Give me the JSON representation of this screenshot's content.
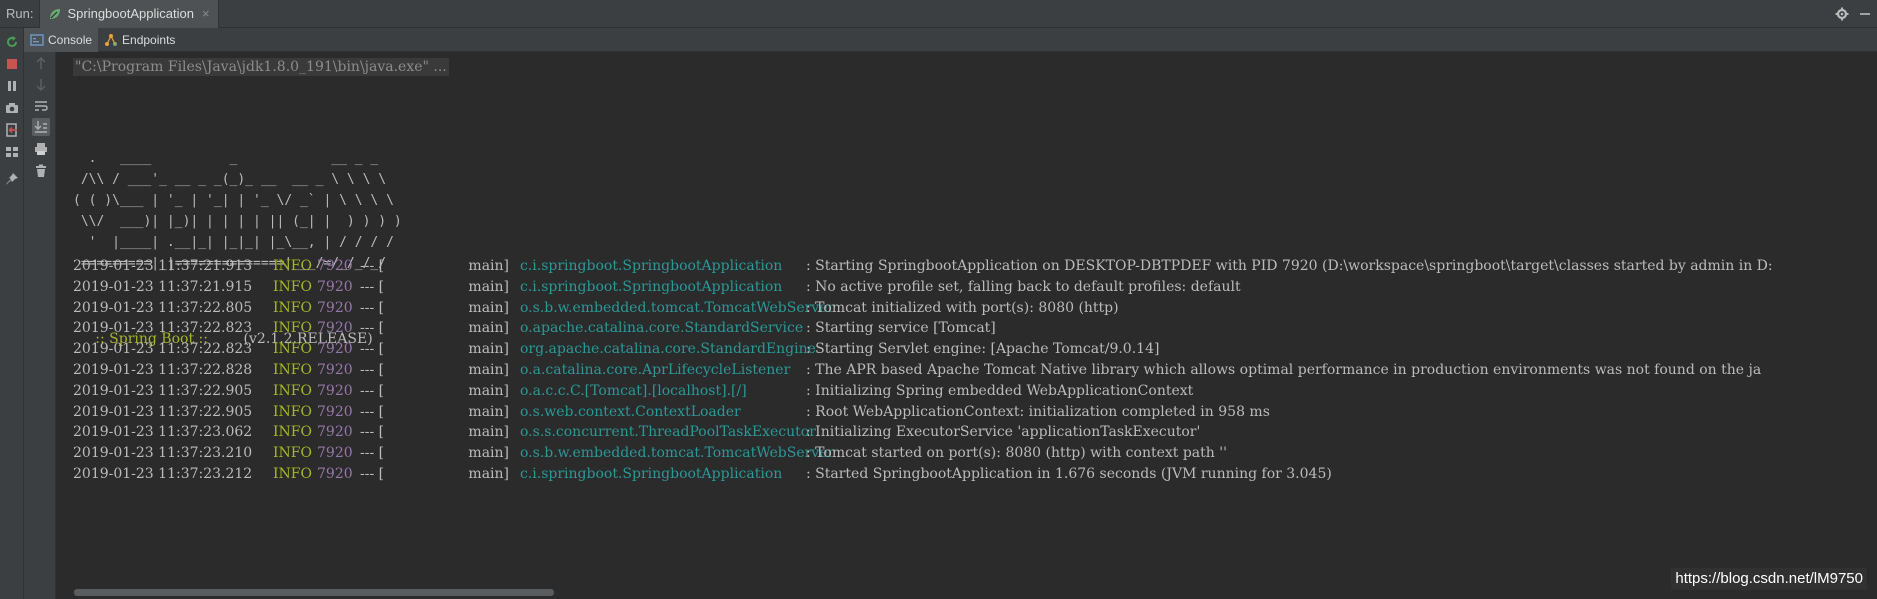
{
  "run_bar": {
    "label": "Run:",
    "tab_title": "SpringbootApplication",
    "tab_close": "×"
  },
  "sub_tabs": [
    {
      "label": "Console"
    },
    {
      "label": "Endpoints"
    }
  ],
  "console": {
    "command": "\"C:\\Program Files\\Java\\jdk1.8.0_191\\bin\\java.exe\" ...",
    "banner": "  .   ____          _            __ _ _\n /\\\\ / ___'_ __ _ _(_)_ __  __ _ \\ \\ \\ \\\n( ( )\\___ | '_ | '_| | '_ \\/ _` | \\ \\ \\ \\\n \\\\/  ___)| |_)| | | | | || (_| |  ) ) ) )\n  '  |____| .__|_| |_|_| |_\\__, | / / / /\n =========|_|==============|___/=/_/_/_/",
    "spring_name": " :: Spring Boot :: ",
    "spring_version": "       (v2.1.2.RELEASE)",
    "log_lines": [
      {
        "ts": "2019-01-23 11:37:21.913",
        "level": "INFO",
        "pid": "7920",
        "sep": "--- [",
        "thread": "main]",
        "logger": "c.i.springboot.SpringbootApplication",
        "msg": ": Starting SpringbootApplication on DESKTOP-DBTPDEF with PID 7920 (D:\\workspace\\springboot\\target\\classes started by admin in D:"
      },
      {
        "ts": "2019-01-23 11:37:21.915",
        "level": "INFO",
        "pid": "7920",
        "sep": "--- [",
        "thread": "main]",
        "logger": "c.i.springboot.SpringbootApplication",
        "msg": ": No active profile set, falling back to default profiles: default"
      },
      {
        "ts": "2019-01-23 11:37:22.805",
        "level": "INFO",
        "pid": "7920",
        "sep": "--- [",
        "thread": "main]",
        "logger": "o.s.b.w.embedded.tomcat.TomcatWebServer",
        "msg": ": Tomcat initialized with port(s): 8080 (http)"
      },
      {
        "ts": "2019-01-23 11:37:22.823",
        "level": "INFO",
        "pid": "7920",
        "sep": "--- [",
        "thread": "main]",
        "logger": "o.apache.catalina.core.StandardService",
        "msg": ": Starting service [Tomcat]"
      },
      {
        "ts": "2019-01-23 11:37:22.823",
        "level": "INFO",
        "pid": "7920",
        "sep": "--- [",
        "thread": "main]",
        "logger": "org.apache.catalina.core.StandardEngine",
        "msg": ": Starting Servlet engine: [Apache Tomcat/9.0.14]"
      },
      {
        "ts": "2019-01-23 11:37:22.828",
        "level": "INFO",
        "pid": "7920",
        "sep": "--- [",
        "thread": "main]",
        "logger": "o.a.catalina.core.AprLifecycleListener",
        "msg": ": The APR based Apache Tomcat Native library which allows optimal performance in production environments was not found on the ja"
      },
      {
        "ts": "2019-01-23 11:37:22.905",
        "level": "INFO",
        "pid": "7920",
        "sep": "--- [",
        "thread": "main]",
        "logger": "o.a.c.c.C.[Tomcat].[localhost].[/]",
        "msg": ": Initializing Spring embedded WebApplicationContext"
      },
      {
        "ts": "2019-01-23 11:37:22.905",
        "level": "INFO",
        "pid": "7920",
        "sep": "--- [",
        "thread": "main]",
        "logger": "o.s.web.context.ContextLoader",
        "msg": ": Root WebApplicationContext: initialization completed in 958 ms"
      },
      {
        "ts": "2019-01-23 11:37:23.062",
        "level": "INFO",
        "pid": "7920",
        "sep": "--- [",
        "thread": "main]",
        "logger": "o.s.s.concurrent.ThreadPoolTaskExecutor",
        "msg": ": Initializing ExecutorService 'applicationTaskExecutor'"
      },
      {
        "ts": "2019-01-23 11:37:23.210",
        "level": "INFO",
        "pid": "7920",
        "sep": "--- [",
        "thread": "main]",
        "logger": "o.s.b.w.embedded.tomcat.TomcatWebServer",
        "msg": ": Tomcat started on port(s): 8080 (http) with context path ''"
      },
      {
        "ts": "2019-01-23 11:37:23.212",
        "level": "INFO",
        "pid": "7920",
        "sep": "--- [",
        "thread": "main]",
        "logger": "c.i.springboot.SpringbootApplication",
        "msg": ": Started SpringbootApplication in 1.676 seconds (JVM running for 3.045)"
      }
    ]
  },
  "watermark": "https://blog.csdn.net/lM9750",
  "icons": {
    "left_strip": [
      "rerun-icon",
      "stop-icon",
      "pause-icon",
      "camera-icon",
      "exit-icon",
      "layout-icon",
      "pin-icon"
    ],
    "tool_strip": [
      "up-arrow-icon",
      "down-arrow-icon",
      "soft-wrap-icon",
      "scroll-to-end-icon",
      "print-icon",
      "trash-icon"
    ],
    "top_right": [
      "gear-icon",
      "minimize-icon"
    ]
  },
  "colors": {
    "background": "#2b2b2b",
    "panel": "#3c3f41",
    "info_level": "#a7b627",
    "pid": "#9876aa",
    "logger": "#299999",
    "text": "#bbbbbb",
    "stop": "#c75450",
    "rerun": "#499c54"
  }
}
